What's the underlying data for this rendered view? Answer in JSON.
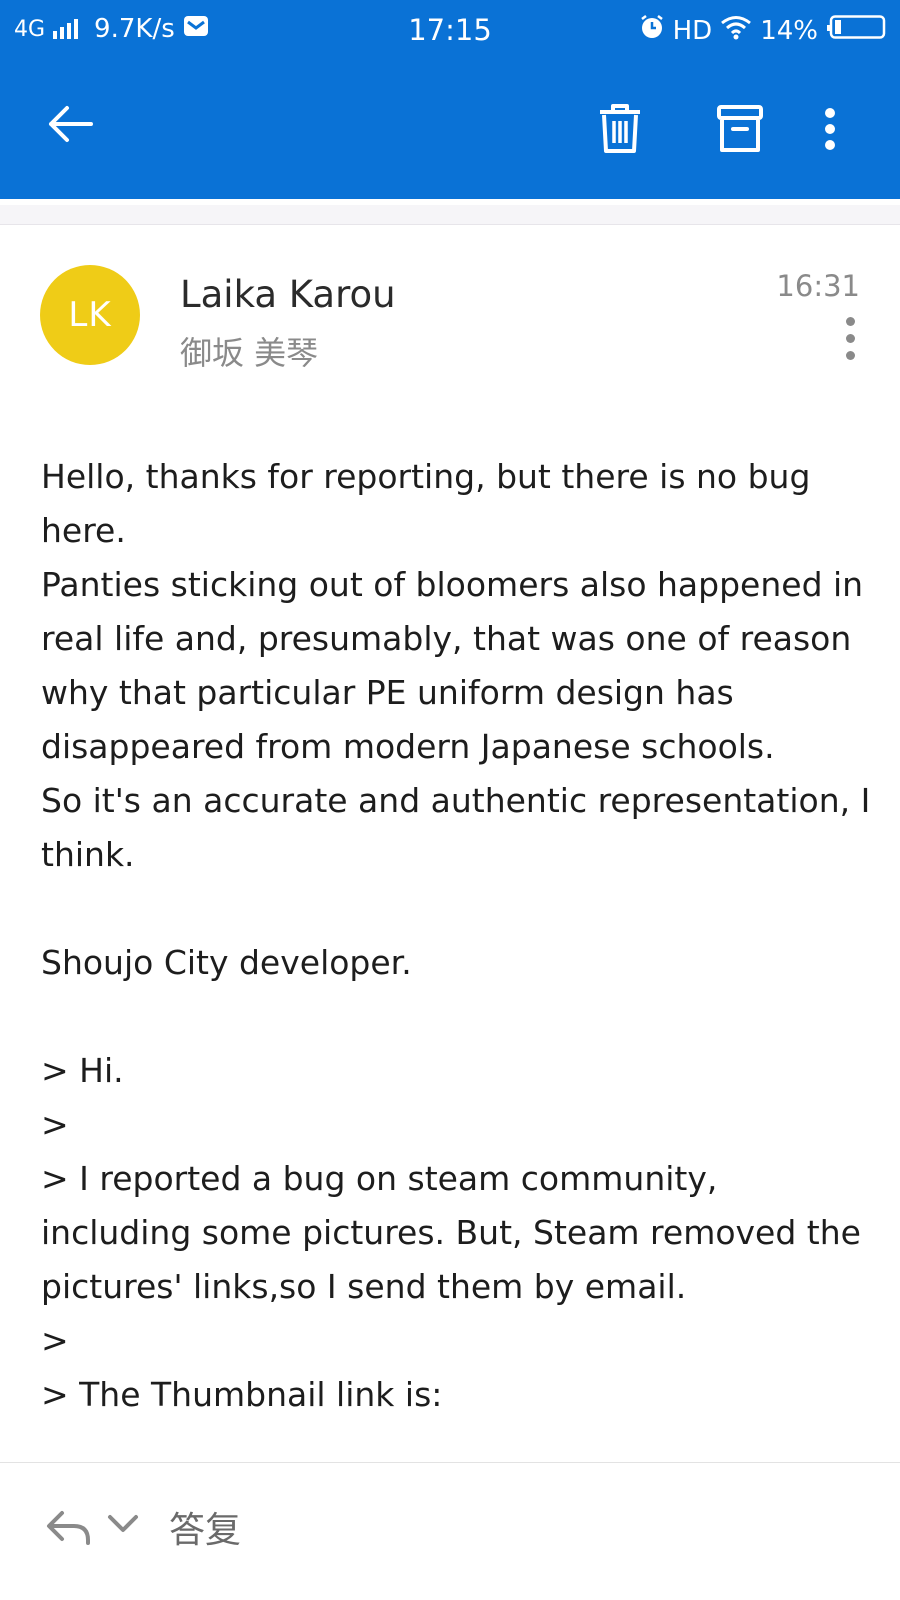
{
  "status_bar": {
    "network": "4G",
    "speed": "9.7K/s",
    "time": "17:15",
    "hd": "HD",
    "battery": "14%"
  },
  "toolbar": {
    "back_icon": "arrow-left-icon",
    "delete_icon": "trash-icon",
    "archive_icon": "archive-icon",
    "more_icon": "more-vertical-icon"
  },
  "message": {
    "avatar_initials": "LK",
    "avatar_color": "#efcc17",
    "sender_name": "Laika Karou",
    "sender_alias": "御坂 美琴",
    "time": "16:31",
    "body": [
      "Hello, thanks for reporting, but there is no bug here.",
      "Panties sticking out of bloomers also happened in real life and, presumably, that was one of reason why that particular PE uniform design has disappeared from modern Japanese schools.",
      "So it's an accurate and authentic representation, I think.",
      "",
      "Shoujo City developer.",
      "",
      "> Hi.",
      ">",
      "> I reported a bug on steam community, including some pictures. But, Steam removed the pictures' links,so I send them by email.",
      ">",
      "> The Thumbnail link is:"
    ]
  },
  "bottom_bar": {
    "reply_label": "答复"
  },
  "colors": {
    "accent": "#0a72d6",
    "avatar": "#efcc17"
  }
}
